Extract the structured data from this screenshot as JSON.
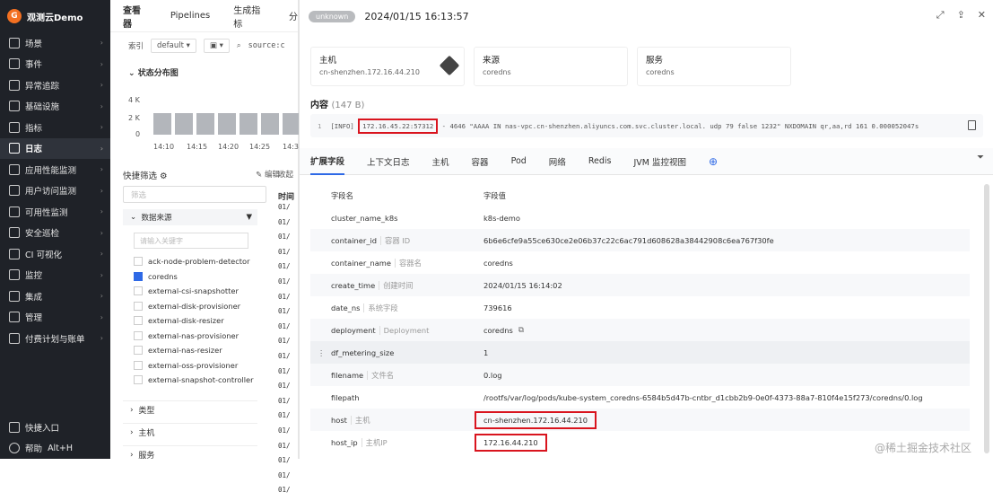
{
  "app": {
    "name": "观测云Demo",
    "logo_letter": "G"
  },
  "sidebar": {
    "items": [
      {
        "label": "场景",
        "icon": "scene-icon"
      },
      {
        "label": "事件",
        "icon": "event-icon"
      },
      {
        "label": "异常追踪",
        "icon": "anomaly-icon"
      },
      {
        "label": "基础设施",
        "icon": "infra-icon"
      },
      {
        "label": "指标",
        "icon": "metric-icon"
      },
      {
        "label": "日志",
        "icon": "log-icon",
        "active": true
      },
      {
        "label": "应用性能监测",
        "icon": "apm-icon"
      },
      {
        "label": "用户访问监测",
        "icon": "rum-icon"
      },
      {
        "label": "可用性监测",
        "icon": "availability-icon"
      },
      {
        "label": "安全巡检",
        "icon": "security-icon"
      },
      {
        "label": "CI 可视化",
        "icon": "ci-icon"
      },
      {
        "label": "监控",
        "icon": "monitor-icon"
      },
      {
        "label": "集成",
        "icon": "integration-icon"
      },
      {
        "label": "管理",
        "icon": "manage-icon"
      },
      {
        "label": "付费计划与账单",
        "icon": "billing-icon"
      }
    ],
    "quick_entry": "快捷入口",
    "help": "帮助",
    "help_shortcut": "Alt+H"
  },
  "mid": {
    "tabs": [
      "查看器",
      "Pipelines",
      "生成指标",
      "分"
    ],
    "index_label": "索引",
    "index_value": "default",
    "query": "source:c",
    "dist_title": "状态分布图",
    "y_ticks": [
      "4 K",
      "2 K",
      "0"
    ],
    "x_ticks": [
      "14:10",
      "14:15",
      "14:20",
      "14:25",
      "14:3"
    ],
    "quick_filter": "快捷筛选",
    "edit": "编辑",
    "filter_placeholder": "筛选",
    "source_header": "数据来源",
    "source_search": "请输入关键字",
    "sources": [
      {
        "name": "ack-node-problem-detector",
        "checked": false
      },
      {
        "name": "coredns",
        "checked": true
      },
      {
        "name": "external-csi-snapshotter",
        "checked": false
      },
      {
        "name": "external-disk-provisioner",
        "checked": false
      },
      {
        "name": "external-disk-resizer",
        "checked": false
      },
      {
        "name": "external-nas-provisioner",
        "checked": false
      },
      {
        "name": "external-nas-resizer",
        "checked": false
      },
      {
        "name": "external-oss-provisioner",
        "checked": false
      },
      {
        "name": "external-snapshot-controller",
        "checked": false
      }
    ],
    "collapsed": [
      "类型",
      "主机",
      "服务"
    ],
    "time_header": "时间",
    "collect_label": "收起",
    "time_cells": [
      "01/",
      "01/",
      "01/",
      "01/",
      "01/",
      "01/",
      "01/",
      "01/",
      "01/",
      "01/",
      "01/",
      "01/",
      "01/",
      "01/",
      "01/",
      "01/",
      "01/",
      "01/",
      "01/",
      "01/"
    ]
  },
  "panel": {
    "badge": "unknown",
    "timestamp": "2024/01/15 16:13:57",
    "cards": [
      {
        "label": "主机",
        "value": "cn-shenzhen.172.16.44.210"
      },
      {
        "label": "来源",
        "value": "coredns"
      },
      {
        "label": "服务",
        "value": "coredns"
      }
    ],
    "content_title": "内容",
    "content_size": "(147 B)",
    "code_line_no": "1",
    "code_prefix": "[INFO]",
    "code_ip": "172.16.45.22:57312",
    "code_rest": "- 4646 \"AAAA IN nas-vpc.cn-shenzhen.aliyuncs.com.svc.cluster.local. udp 79 false 1232\" NXDOMAIN qr,aa,rd 161 0.000052047s",
    "tabs": [
      "扩展字段",
      "上下文日志",
      "主机",
      "容器",
      "Pod",
      "网络",
      "Redis",
      "JVM 监控视图"
    ],
    "col_name": "字段名",
    "col_value": "字段值",
    "fields": [
      {
        "key": "cluster_name_k8s",
        "desc": "",
        "value": "k8s-demo"
      },
      {
        "key": "container_id",
        "desc": "容器 ID",
        "value": "6b6e6cfe9a55ce630ce2e06b37c22c6ac791d608628a38442908c6ea767f30fe"
      },
      {
        "key": "container_name",
        "desc": "容器名",
        "value": "coredns"
      },
      {
        "key": "create_time",
        "desc": "创建时间",
        "value": "2024/01/15 16:14:02"
      },
      {
        "key": "date_ns",
        "desc": "系统字段",
        "value": "739616"
      },
      {
        "key": "deployment",
        "desc": "Deployment",
        "value": "coredns"
      },
      {
        "key": "df_metering_size",
        "desc": "",
        "value": "1"
      },
      {
        "key": "filename",
        "desc": "文件名",
        "value": "0.log"
      },
      {
        "key": "filepath",
        "desc": "",
        "value": "/rootfs/var/log/pods/kube-system_coredns-6584b5d47b-cntbr_d1cbb2b9-0e0f-4373-88a7-810f4e15f273/coredns/0.log"
      },
      {
        "key": "host",
        "desc": "主机",
        "value": "cn-shenzhen.172.16.44.210"
      },
      {
        "key": "host_ip",
        "desc": "主机IP",
        "value": "172.16.44.210"
      }
    ]
  },
  "watermark": "@稀土掘金技术社区",
  "colors": {
    "sidebar_bg": "#1f2228",
    "accent": "#2e69e6",
    "highlight": "#d9141e"
  }
}
